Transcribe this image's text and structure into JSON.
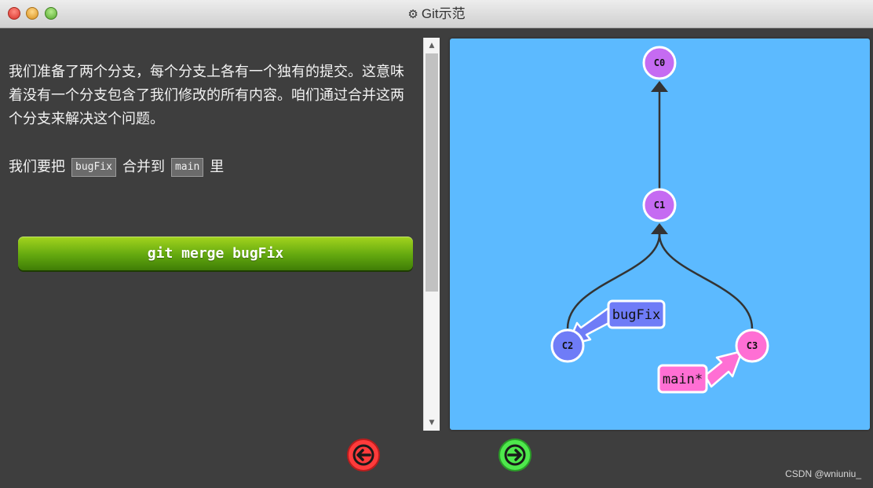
{
  "window": {
    "title": "Git示范",
    "title_icon": "gear-icon"
  },
  "instructions": {
    "paragraph1": "我们准备了两个分支，每个分支上各有一个独有的提交。这意味着没有一个分支包含了我们修改的所有内容。咱们通过合并这两个分支来解决这个问题。",
    "paragraph2_prefix": "我们要把",
    "paragraph2_code1": "bugFix",
    "paragraph2_middle": "合并到",
    "paragraph2_code2": "main",
    "paragraph2_suffix": "里"
  },
  "command_button": {
    "label": "git merge bugFix",
    "color": "#63a80f"
  },
  "visualization": {
    "background": "#5cbaff",
    "commits": [
      {
        "id": "C0",
        "color": "#c56bf2"
      },
      {
        "id": "C1",
        "color": "#c56bf2"
      },
      {
        "id": "C2",
        "color": "#6f7cf7"
      },
      {
        "id": "C3",
        "color": "#ff6fd4"
      }
    ],
    "branches": [
      {
        "name": "bugFix",
        "target": "C2",
        "color": "#6f7cf7"
      },
      {
        "name": "main*",
        "target": "C3",
        "color": "#ff6fd4"
      }
    ]
  },
  "navigation": {
    "back_icon": "arrow-left-icon",
    "back_color": "#ff3b3b",
    "forward_icon": "arrow-right-icon",
    "forward_color": "#4ee84c"
  },
  "watermark": "CSDN @wniuniu_"
}
